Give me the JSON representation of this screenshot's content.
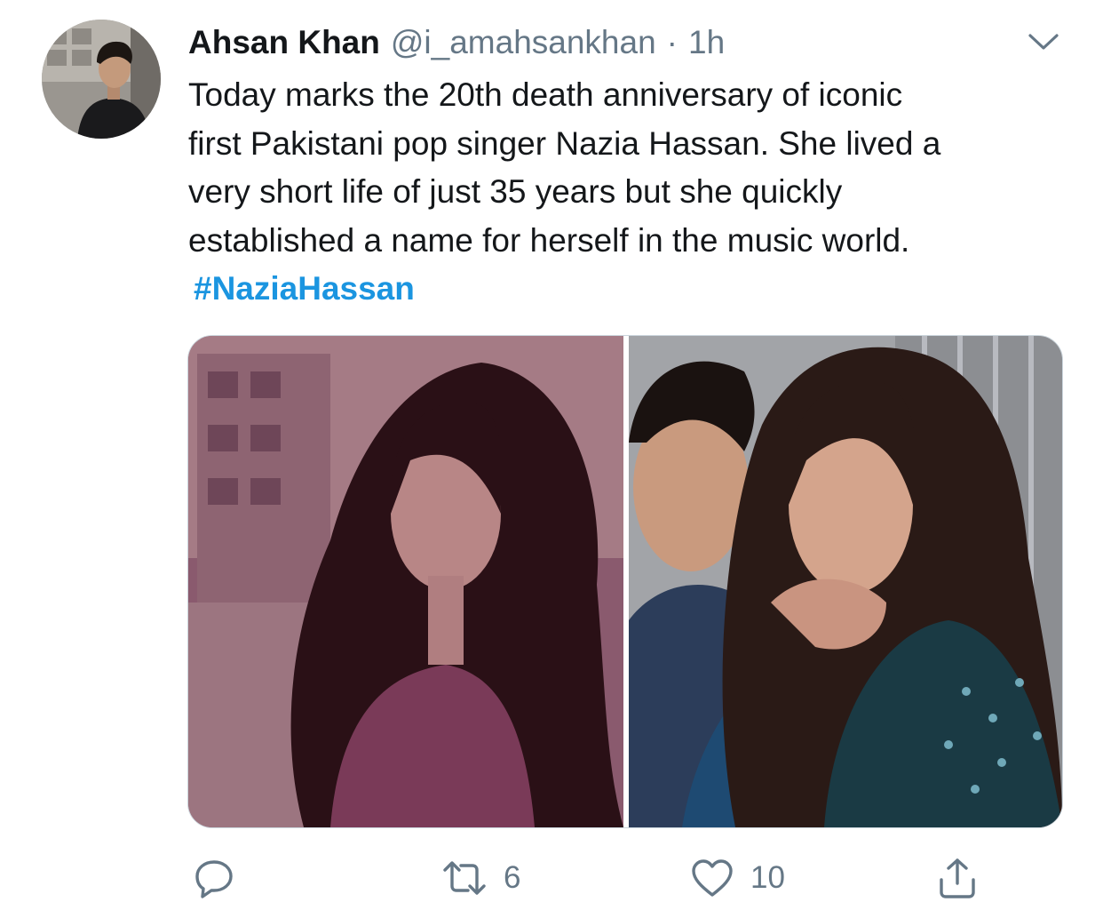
{
  "tweet": {
    "author": {
      "display_name": "Ahsan Khan",
      "handle": "@i_amahsankhan",
      "separator": "·",
      "time": "1h"
    },
    "text_lines": [
      "Today marks the 20th death anniversary of iconic",
      "first Pakistani pop singer Nazia Hassan. She lived a",
      "very short life of just 35 years but she quickly",
      "established a name for herself in the music world."
    ],
    "hashtag": "#NaziaHassan",
    "media": [
      {
        "icon": "photo-sepia-portrait"
      },
      {
        "icon": "photo-duo-portrait"
      }
    ],
    "actions": {
      "reply": {
        "icon": "reply-icon",
        "count": ""
      },
      "retweet": {
        "icon": "retweet-icon",
        "count": "6"
      },
      "like": {
        "icon": "heart-icon",
        "count": "10"
      },
      "share": {
        "icon": "share-icon",
        "count": ""
      }
    }
  },
  "colors": {
    "text": "#14171a",
    "secondary": "#657786",
    "link": "#1b95e0",
    "border": "#ccd6dd"
  }
}
